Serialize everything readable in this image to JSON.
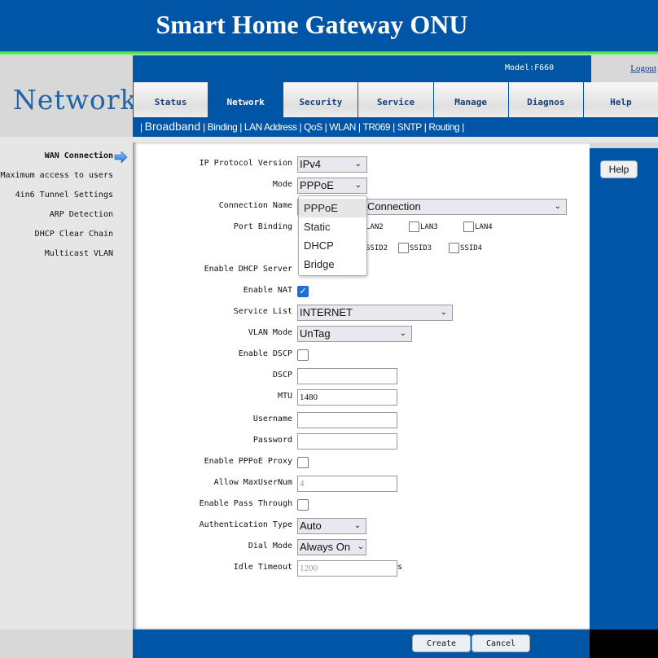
{
  "header": {
    "title": "Smart Home Gateway ONU",
    "model_label": "Model:",
    "model_value": "F660",
    "logout": "Logout"
  },
  "section_title": "Network",
  "tabs": [
    {
      "label": "Status",
      "active": false
    },
    {
      "label": "Network",
      "active": true
    },
    {
      "label": "Security",
      "active": false
    },
    {
      "label": "Service",
      "active": false
    },
    {
      "label": "Manage",
      "active": false
    },
    {
      "label": "Diagnos",
      "active": false
    },
    {
      "label": "Help",
      "active": false
    }
  ],
  "subnav": [
    "Broadband",
    "Binding",
    "LAN Address",
    "QoS",
    "WLAN",
    "TR069",
    "SNTP",
    "Routing"
  ],
  "sidebar": {
    "items": [
      {
        "label": "WAN Connection",
        "current": true
      },
      {
        "label": "Maximum access to users"
      },
      {
        "label": "4in6 Tunnel Settings"
      },
      {
        "label": "ARP Detection"
      },
      {
        "label": "DHCP Clear Chain"
      },
      {
        "label": "Multicast VLAN"
      }
    ]
  },
  "form": {
    "ip_protocol_version": {
      "label": "IP Protocol Version",
      "value": "IPv4"
    },
    "mode": {
      "label": "Mode",
      "value": "PPPoE",
      "options": [
        "PPPoE",
        "Static",
        "DHCP",
        "Bridge"
      ],
      "highlighted": "PPPoE"
    },
    "connection_name": {
      "label": "Connection Name",
      "value": "Connection"
    },
    "port_binding": {
      "label": "Port Binding",
      "lan": [
        "LAN2",
        "LAN3",
        "LAN4"
      ],
      "ssid": [
        "SSID2",
        "SSID3",
        "SSID4"
      ]
    },
    "enable_dhcp_server": {
      "label": "Enable DHCP Server"
    },
    "enable_nat": {
      "label": "Enable NAT",
      "checked": true
    },
    "service_list": {
      "label": "Service List",
      "value": "INTERNET"
    },
    "vlan_mode": {
      "label": "VLAN Mode",
      "value": "UnTag"
    },
    "enable_dscp": {
      "label": "Enable DSCP",
      "checked": false
    },
    "dscp": {
      "label": "DSCP",
      "value": ""
    },
    "mtu": {
      "label": "MTU",
      "value": "1480"
    },
    "username": {
      "label": "Username",
      "value": ""
    },
    "password": {
      "label": "Password",
      "value": ""
    },
    "enable_pppoe_proxy": {
      "label": "Enable PPPoE Proxy",
      "checked": false
    },
    "allow_maxusernum": {
      "label": "Allow MaxUserNum",
      "value": "4"
    },
    "enable_pass_through": {
      "label": "Enable Pass Through",
      "checked": false
    },
    "authentication_type": {
      "label": "Authentication Type",
      "value": "Auto"
    },
    "dial_mode": {
      "label": "Dial Mode",
      "value": "Always On"
    },
    "idle_timeout": {
      "label": "Idle Timeout",
      "value": "1200",
      "unit": "s"
    }
  },
  "buttons": {
    "help": "Help",
    "create": "Create",
    "cancel": "Cancel"
  },
  "icons": {
    "chevron": "⌄",
    "check": "✓"
  }
}
